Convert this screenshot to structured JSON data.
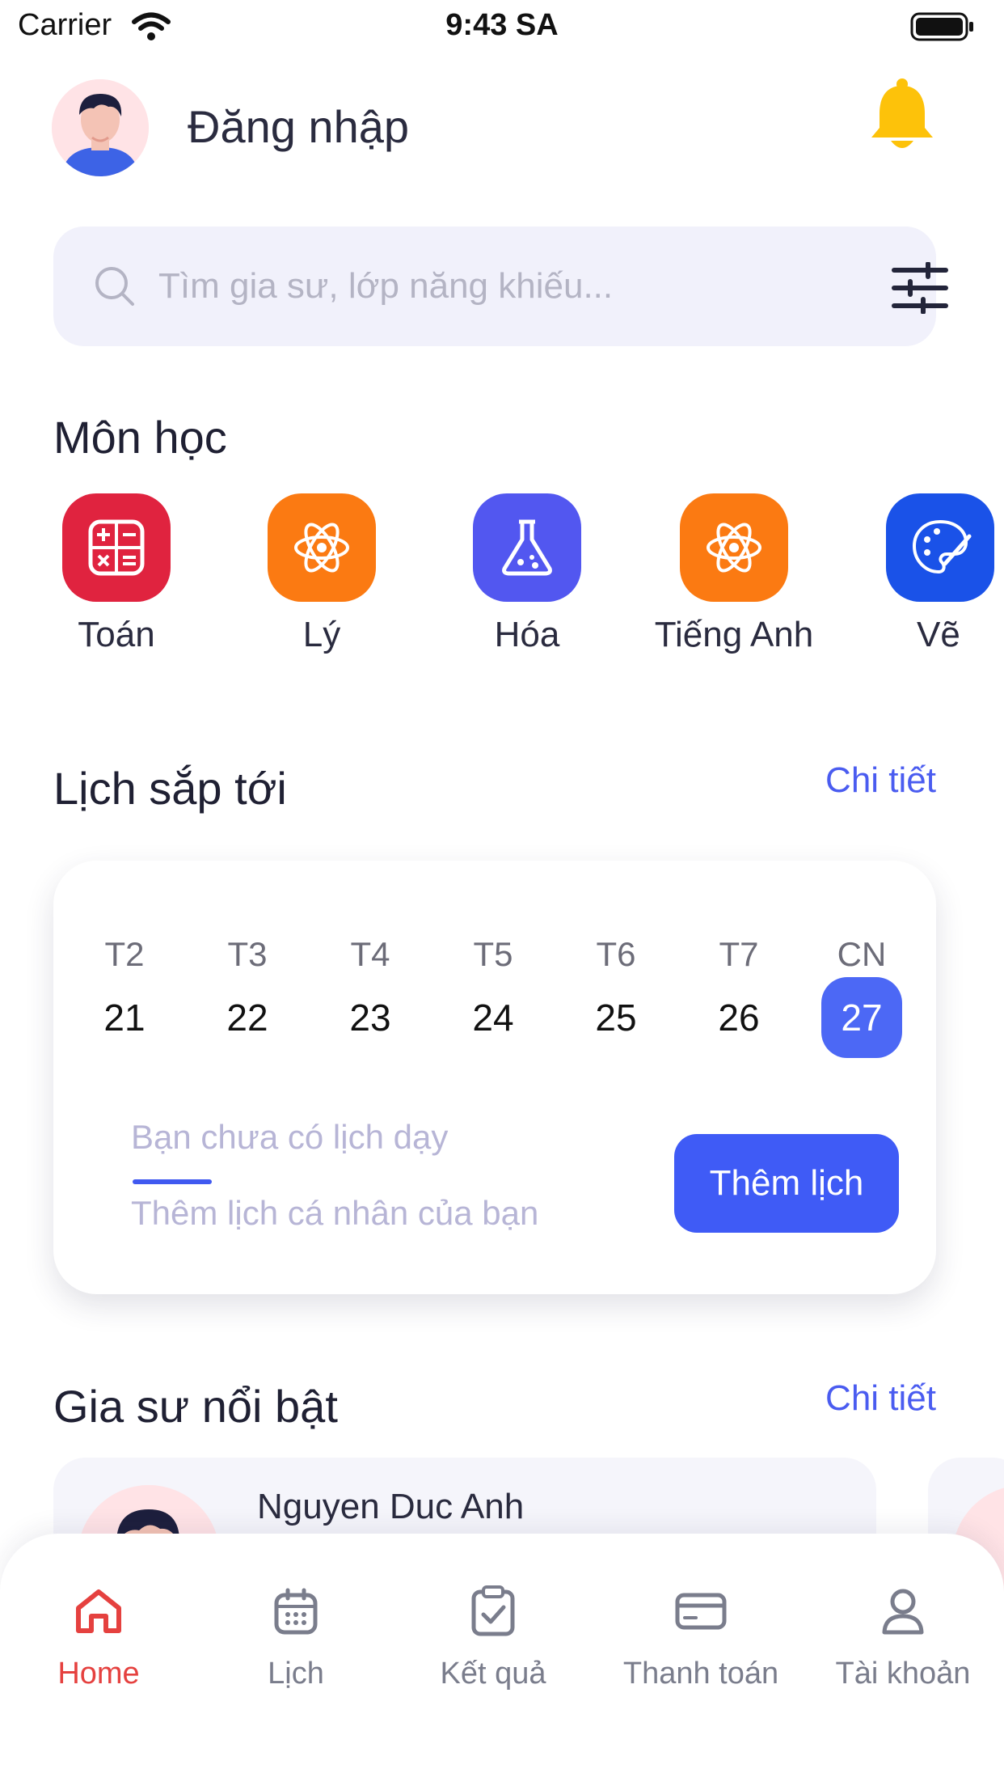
{
  "status_bar": {
    "carrier": "Carrier",
    "time": "9:43 SA"
  },
  "header": {
    "login_label": "Đăng nhập"
  },
  "search": {
    "placeholder": "Tìm gia sư, lớp năng khiếu..."
  },
  "subjects": {
    "title": "Môn học",
    "items": [
      {
        "label": "Toán",
        "icon": "calculator-icon",
        "color": "#e0233f"
      },
      {
        "label": "Lý",
        "icon": "atom-icon",
        "color": "#fb7a12"
      },
      {
        "label": "Hóa",
        "icon": "flask-icon",
        "color": "#5257f0"
      },
      {
        "label": "Tiếng Anh",
        "icon": "atom-icon",
        "color": "#fb7a12"
      },
      {
        "label": "Vẽ",
        "icon": "palette-icon",
        "color": "#1a52e8"
      }
    ]
  },
  "schedule": {
    "title": "Lịch sắp tới",
    "detail_link": "Chi tiết",
    "weekdays": [
      "T2",
      "T3",
      "T4",
      "T5",
      "T6",
      "T7",
      "CN"
    ],
    "days": [
      "21",
      "22",
      "23",
      "24",
      "25",
      "26",
      "27"
    ],
    "selected_day": "27",
    "empty_title": "Bạn chưa có lịch dạy",
    "empty_subtitle": "Thêm lịch cá nhân của bạn",
    "add_button": "Thêm lịch"
  },
  "tutors": {
    "title": "Gia sư nổi bật",
    "detail_link": "Chi tiết",
    "items": [
      {
        "name": "Nguyen Duc Anh"
      }
    ]
  },
  "tabs": [
    {
      "label": "Home",
      "icon": "home-icon",
      "active": true
    },
    {
      "label": "Lịch",
      "icon": "calendar-icon",
      "active": false
    },
    {
      "label": "Kết quả",
      "icon": "clipboard-check-icon",
      "active": false
    },
    {
      "label": "Thanh toán",
      "icon": "credit-card-icon",
      "active": false
    },
    {
      "label": "Tài khoản",
      "icon": "user-icon",
      "active": false
    }
  ],
  "colors": {
    "accent": "#3f5bf6",
    "link": "#4a5cf0",
    "active_tab": "#e5413f",
    "bell": "#fdc20a",
    "search_bg": "#f1f1fb"
  }
}
